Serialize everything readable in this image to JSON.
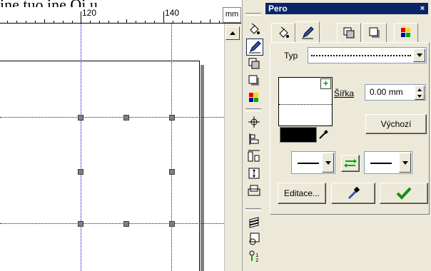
{
  "caption": "ine tuo ine Oi u.",
  "ruler": {
    "label_120": "120",
    "label_140": "140",
    "unit": "mm"
  },
  "panel": {
    "title": "Pero",
    "close_label": "×",
    "type_label": "Typ",
    "width_label": "Šířka",
    "width_value": "0.00 mm",
    "default_button": "Výchozí",
    "edit_button": "Editace...",
    "swap_icon": "swap-arrows-icon",
    "apply_icon": "checkmark-icon",
    "pen_color": "#000000"
  },
  "tabs": [
    {
      "icon": "fill-bucket-icon",
      "active": false
    },
    {
      "icon": "pen-icon",
      "active": true
    },
    {
      "icon": "transparency-icon",
      "active": false
    },
    {
      "icon": "shadow-icon",
      "active": false
    },
    {
      "icon": "color-palette-icon",
      "active": false
    }
  ],
  "toolbar": [
    "fill-bucket-icon",
    "pen-icon",
    "transparency-icon",
    "shadow-icon",
    "color-palette-icon",
    "transform-icon",
    "align-icon",
    "distribute-icon",
    "size-icon",
    "combine-icon",
    "layers-icon",
    "object-props-icon",
    "find-replace-icon"
  ]
}
